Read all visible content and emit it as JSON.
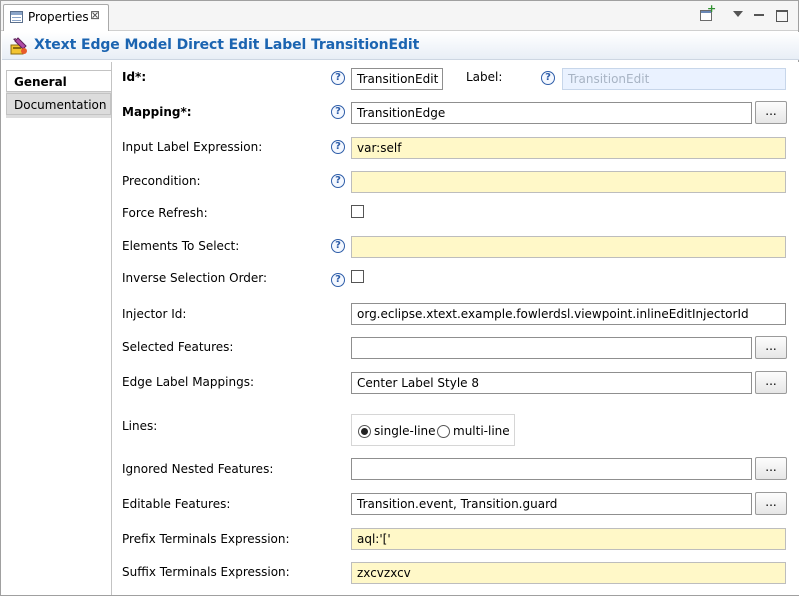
{
  "view": {
    "tab_label": "Properties",
    "title": "Xtext Edge Model Direct Edit Label TransitionEdit"
  },
  "side_tabs": [
    "General",
    "Documentation"
  ],
  "form": {
    "id": {
      "label": "Id*:",
      "value": "TransitionEdit"
    },
    "label_field": {
      "label": "Label:",
      "value": "TransitionEdit"
    },
    "mapping": {
      "label": "Mapping*:",
      "value": "TransitionEdge",
      "browse": "..."
    },
    "input_label_expression": {
      "label": "Input Label Expression:",
      "value": "var:self"
    },
    "precondition": {
      "label": "Precondition:",
      "value": ""
    },
    "force_refresh": {
      "label": "Force Refresh:",
      "checked": false
    },
    "elements_to_select": {
      "label": "Elements To Select:",
      "value": ""
    },
    "inverse_selection_order": {
      "label": "Inverse Selection Order:",
      "checked": false
    },
    "injector_id": {
      "label": "Injector Id:",
      "value": "org.eclipse.xtext.example.fowlerdsl.viewpoint.inlineEditInjectorId"
    },
    "selected_features": {
      "label": "Selected Features:",
      "value": "",
      "browse": "..."
    },
    "edge_label_mappings": {
      "label": "Edge Label Mappings:",
      "value": "Center Label Style 8",
      "browse": "..."
    },
    "lines": {
      "label": "Lines:",
      "options": [
        "single-line",
        "multi-line"
      ],
      "selected": "single-line"
    },
    "ignored_nested_features": {
      "label": "Ignored Nested Features:",
      "value": "",
      "browse": "..."
    },
    "editable_features": {
      "label": "Editable Features:",
      "value": "Transition.event, Transition.guard",
      "browse": "..."
    },
    "prefix_terminals_expression": {
      "label": "Prefix Terminals Expression:",
      "value": "aql:'['"
    },
    "suffix_terminals_expression": {
      "label": "Suffix Terminals Expression:",
      "value": "zxcvzxcv"
    }
  },
  "help_glyph": "?",
  "close_glyph": "⊠",
  "colors": {
    "title": "#1b64b1",
    "expression_field_bg": "#fff8c8",
    "disabled_field_bg": "#eaf2ff",
    "help_icon": "#2e5da8"
  }
}
